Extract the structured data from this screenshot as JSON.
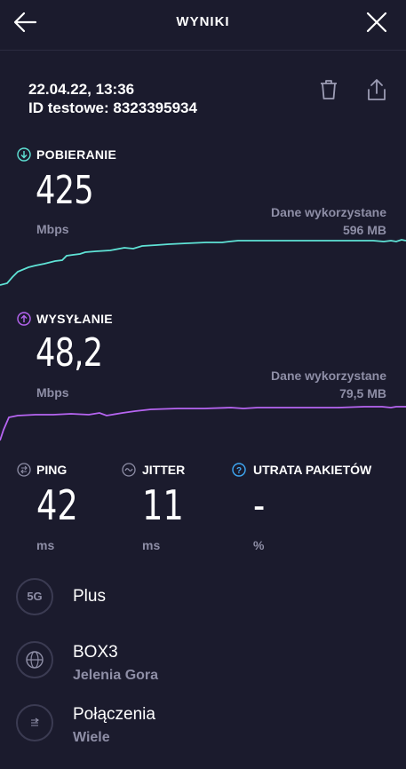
{
  "header": {
    "title": "WYNIKI"
  },
  "test": {
    "datetime": "22.04.22, 13:36",
    "id_label": "ID testowe: 8323395934"
  },
  "download": {
    "label": "POBIERANIE",
    "value": "425",
    "unit": "Mbps",
    "data_used_label": "Dane wykorzystane",
    "data_used_value": "596 MB",
    "color": "#5fe3d6"
  },
  "upload": {
    "label": "WYSYŁANIE",
    "value": "48,2",
    "unit": "Mbps",
    "data_used_label": "Dane wykorzystane",
    "data_used_value": "79,5 MB",
    "color": "#b765f2"
  },
  "stats": {
    "ping": {
      "label": "PING",
      "value": "42",
      "unit": "ms"
    },
    "jitter": {
      "label": "JITTER",
      "value": "11",
      "unit": "ms"
    },
    "packet_loss": {
      "label": "UTRATA PAKIETÓW",
      "value": "-",
      "unit": "%"
    }
  },
  "info": {
    "network": {
      "icon_text": "5G",
      "title": "Plus"
    },
    "server": {
      "title": "BOX3",
      "subtitle": "Jelenia Gora"
    },
    "connections": {
      "title": "Połączenia",
      "subtitle": "Wiele"
    }
  }
}
